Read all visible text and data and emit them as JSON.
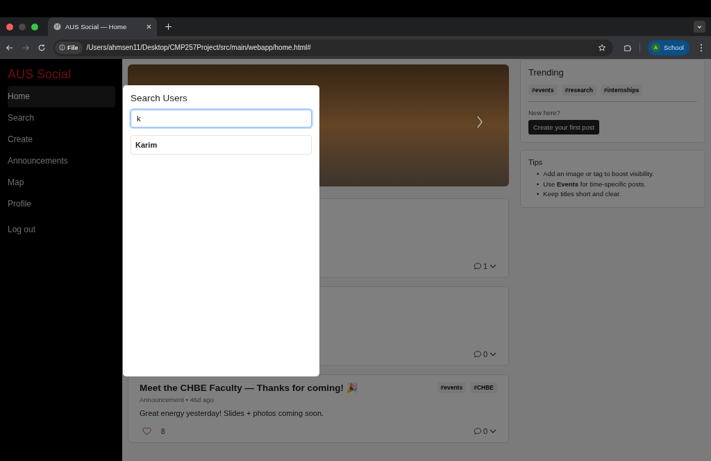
{
  "browser": {
    "tab_title": "AUS Social — Home",
    "address_label": "File",
    "url": "/Users/ahmsen11/Desktop/CMP257Project/src/main/webapp/home.html#",
    "profile_initial": "A",
    "profile_name": "School"
  },
  "sidebar": {
    "brand": "AUS Social",
    "items": [
      {
        "label": "Home",
        "selected": true
      },
      {
        "label": "Search",
        "selected": false
      },
      {
        "label": "Create",
        "selected": false
      },
      {
        "label": "Announcements",
        "selected": false
      },
      {
        "label": "Map",
        "selected": false
      },
      {
        "label": "Profile",
        "selected": false
      }
    ],
    "logout": "Log out"
  },
  "posts": [
    {
      "comments": "1"
    },
    {
      "comments": "0"
    },
    {
      "title": "Meet the CHBE Faculty — Thanks for coming! 🎉",
      "tags": [
        "#events",
        "#CHBE"
      ],
      "meta": "Announcement • 46d ago",
      "body": "Great energy yesterday! Slides + photos coming soon.",
      "likes": "8",
      "liked": false,
      "comments": "0"
    }
  ],
  "trending": {
    "title": "Trending",
    "tags": [
      "#events",
      "#research",
      "#internships"
    ],
    "prompt": "New here?",
    "button": "Create your first post"
  },
  "tips": {
    "title": "Tips",
    "bullet": "•",
    "items": [
      "Add an image or tag to boost visibility.",
      "Use **Events** for time-specific posts.",
      "Keep titles short and clear."
    ]
  },
  "search_modal": {
    "title": "Search Users",
    "value": "k",
    "results": [
      "Karim"
    ]
  }
}
